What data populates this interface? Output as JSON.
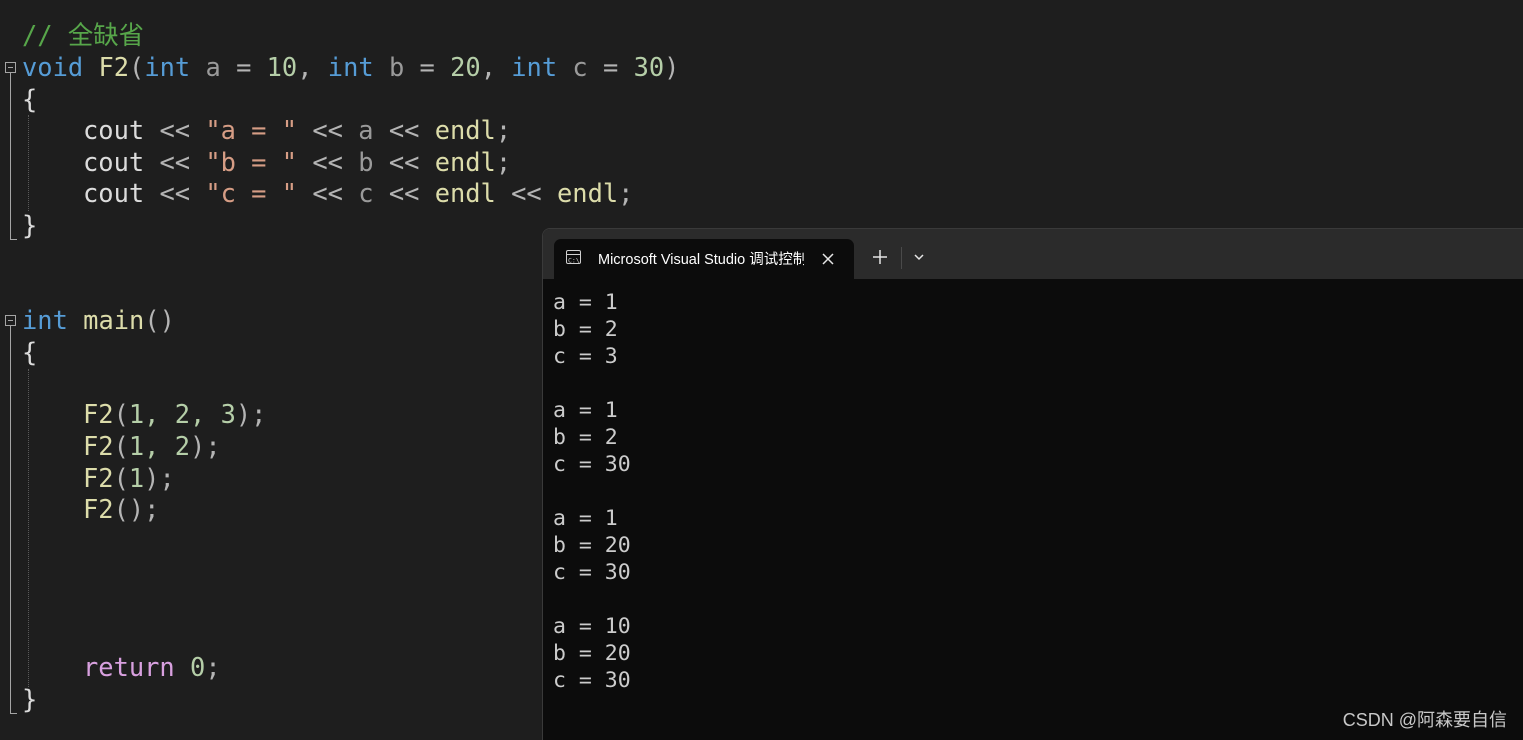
{
  "editor": {
    "comment": "// 全缺省",
    "lines": {
      "sig": {
        "kw1": "void",
        "name": "F2",
        "open": "(",
        "p1t": "int",
        "p1n": "a",
        "p1v": "10",
        "p2t": "int",
        "p2n": "b",
        "p2v": "20",
        "p3t": "int",
        "p3n": "c",
        "p3v": "30",
        "close": ")"
      },
      "open1": "{",
      "out_a": {
        "cout": "cout",
        "op1": "<<",
        "str": "\"a = \"",
        "op2": "<<",
        "var": "a",
        "op3": "<<",
        "endl": "endl",
        "semi": ";"
      },
      "out_b": {
        "cout": "cout",
        "op1": "<<",
        "str": "\"b = \"",
        "op2": "<<",
        "var": "b",
        "op3": "<<",
        "endl": "endl",
        "semi": ";"
      },
      "out_c": {
        "cout": "cout",
        "op1": "<<",
        "str": "\"c = \"",
        "op2": "<<",
        "var": "c",
        "op3": "<<",
        "endl": "endl",
        "op4": "<<",
        "endl2": "endl",
        "semi": ";"
      },
      "close1": "}",
      "main": {
        "kw": "int",
        "name": "main",
        "parens": "()"
      },
      "open2": "{",
      "call1": {
        "name": "F2",
        "args": "1, 2, 3"
      },
      "call2": {
        "name": "F2",
        "args": "1, 2"
      },
      "call3": {
        "name": "F2",
        "args": "1"
      },
      "call4": {
        "name": "F2",
        "args": ""
      },
      "ret": {
        "kw": "return",
        "val": "0",
        "semi": ";"
      },
      "close2": "}"
    }
  },
  "terminal": {
    "tab_title": "Microsoft Visual Studio 调试控制台",
    "close_icon": "close-icon",
    "new_tab_icon": "plus-icon",
    "dropdown_icon": "chevron-down-icon",
    "output": [
      "a = 1",
      "b = 2",
      "c = 3",
      "",
      "a = 1",
      "b = 2",
      "c = 30",
      "",
      "a = 1",
      "b = 20",
      "c = 30",
      "",
      "a = 10",
      "b = 20",
      "c = 30"
    ]
  },
  "watermark": "CSDN @阿森要自信"
}
